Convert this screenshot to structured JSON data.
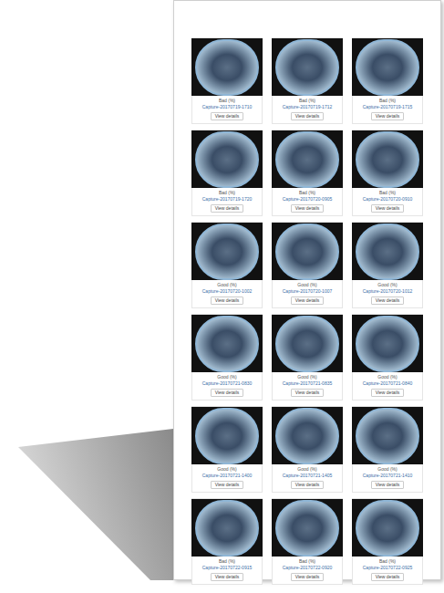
{
  "gallery": {
    "cards": [
      {
        "label": "Bad (%)",
        "filename": "Capture-20170719-1710",
        "button": "View details"
      },
      {
        "label": "Bad (%)",
        "filename": "Capture-20170719-1712",
        "button": "View details"
      },
      {
        "label": "Bad (%)",
        "filename": "Capture-20170719-1715",
        "button": "View details"
      },
      {
        "label": "Bad (%)",
        "filename": "Capture-20170719-1720",
        "button": "View details"
      },
      {
        "label": "Bad (%)",
        "filename": "Capture-20170720-0905",
        "button": "View details"
      },
      {
        "label": "Bad (%)",
        "filename": "Capture-20170720-0910",
        "button": "View details"
      },
      {
        "label": "Good (%)",
        "filename": "Capture-20170720-1002",
        "button": "View details"
      },
      {
        "label": "Good (%)",
        "filename": "Capture-20170720-1007",
        "button": "View details"
      },
      {
        "label": "Good (%)",
        "filename": "Capture-20170720-1012",
        "button": "View details"
      },
      {
        "label": "Good (%)",
        "filename": "Capture-20170721-0830",
        "button": "View details"
      },
      {
        "label": "Good (%)",
        "filename": "Capture-20170721-0835",
        "button": "View details"
      },
      {
        "label": "Good (%)",
        "filename": "Capture-20170721-0840",
        "button": "View details"
      },
      {
        "label": "Good (%)",
        "filename": "Capture-20170721-1400",
        "button": "View details"
      },
      {
        "label": "Good (%)",
        "filename": "Capture-20170721-1405",
        "button": "View details"
      },
      {
        "label": "Good (%)",
        "filename": "Capture-20170721-1410",
        "button": "View details"
      },
      {
        "label": "Bad (%)",
        "filename": "Capture-20170722-0915",
        "button": "View details"
      },
      {
        "label": "Bad (%)",
        "filename": "Capture-20170722-0920",
        "button": "View details"
      },
      {
        "label": "Bad (%)",
        "filename": "Capture-20170722-0925",
        "button": "View details"
      }
    ]
  }
}
